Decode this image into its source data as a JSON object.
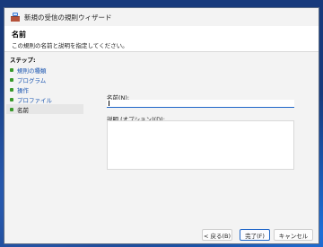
{
  "window": {
    "title": "新規の受信の規則ウィザード"
  },
  "header": {
    "title": "名前",
    "subtitle": "この規則の名前と説明を指定してください。"
  },
  "steps": {
    "label": "ステップ:",
    "items": [
      {
        "label": "規則の種類"
      },
      {
        "label": "プログラム"
      },
      {
        "label": "操作"
      },
      {
        "label": "プロファイル"
      },
      {
        "label": "名前"
      }
    ]
  },
  "form": {
    "name_label": "名前(N):",
    "name_value": "",
    "desc_label": "説明 (オプション)(D):",
    "desc_value": ""
  },
  "buttons": {
    "back": "< 戻る(B)",
    "finish": "完了(F)",
    "cancel": "キャンセル"
  }
}
